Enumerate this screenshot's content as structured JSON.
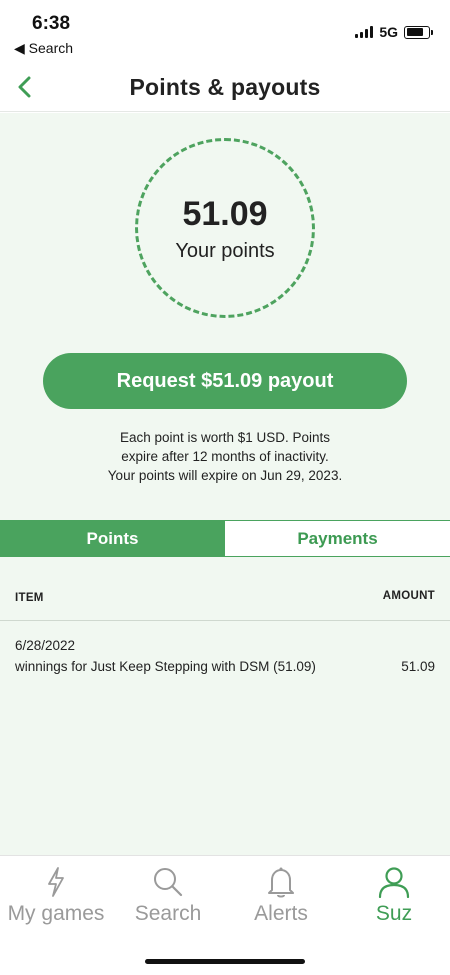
{
  "status_bar": {
    "time": "6:38",
    "back_label": "◀ Search",
    "network": "5G"
  },
  "header": {
    "title": "Points & payouts",
    "back_icon": "chevron-left-icon"
  },
  "points": {
    "value": "51.09",
    "caption": "Your points"
  },
  "payout_button": {
    "label": "Request $51.09 payout"
  },
  "info": {
    "line1": "Each point is worth $1 USD. Points",
    "line2": "expire after 12 months of inactivity.",
    "line3": "Your points will expire on Jun 29, 2023."
  },
  "tabs": [
    {
      "label": "Points",
      "active": true
    },
    {
      "label": "Payments",
      "active": false
    }
  ],
  "table": {
    "columns": [
      "ITEM",
      "AMOUNT"
    ],
    "rows": [
      {
        "date": "6/28/2022",
        "description": "winnings for Just Keep Stepping with DSM (51.09)",
        "amount": "51.09"
      }
    ]
  },
  "bottom_nav": [
    {
      "label": "My games",
      "icon": "lightning-icon",
      "active": false
    },
    {
      "label": "Search",
      "icon": "search-icon",
      "active": false
    },
    {
      "label": "Alerts",
      "icon": "bell-icon",
      "active": false
    },
    {
      "label": "Suz",
      "icon": "user-icon",
      "active": true
    }
  ],
  "colors": {
    "accent": "#4aa35e",
    "background_tint": "#f1f8f1",
    "inactive": "#9a9a9a"
  }
}
